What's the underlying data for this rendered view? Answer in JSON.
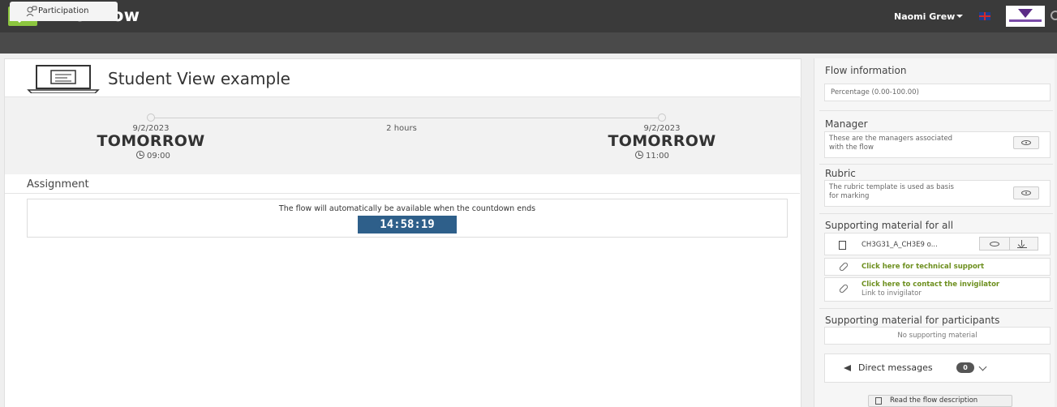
{
  "app": {
    "brand": "WISEflow",
    "logo_icon": "check-logo-icon"
  },
  "header": {
    "user_name": "Naomi Grew",
    "flag_icon": "uk-flag-icon",
    "institution_logo": "institution-logo"
  },
  "tabs": [
    {
      "label": "Participation",
      "icon": "participants-icon"
    }
  ],
  "main": {
    "title": "Student View example",
    "title_icon": "laptop-icon",
    "start": {
      "date": "9/2/2023",
      "day": "TOMORROW",
      "time": "09:00"
    },
    "duration": "2 hours",
    "end": {
      "date": "9/2/2023",
      "day": "TOMORROW",
      "time": "11:00"
    },
    "assignment": {
      "heading": "Assignment",
      "message": "The flow will automatically be available when the countdown ends",
      "countdown": "14:58:19"
    }
  },
  "sidebar": {
    "flow_info": {
      "heading": "Flow information",
      "text": "Percentage (0.00-100.00)"
    },
    "manager": {
      "heading": "Manager",
      "text_line1": "These are the managers associated",
      "text_line2": "with the flow"
    },
    "rubric": {
      "heading": "Rubric",
      "text_line1": "The rubric template is used as basis",
      "text_line2": "for marking"
    },
    "support_all": {
      "heading": "Supporting material for all",
      "file_name": "CH3G31_A_CH3E9 o...",
      "link1": "Click here for technical support",
      "link2": "Click here to contact the invigilator",
      "link2_sub": "Link to invigilator"
    },
    "support_participants": {
      "heading": "Supporting material for participants",
      "empty_text": "No supporting material"
    },
    "direct_messages": {
      "label": "Direct messages",
      "count": "0"
    },
    "read_description": "Read the flow description"
  },
  "colors": {
    "topbar": "#3a3a3a",
    "brand_green": "#8cc63f",
    "countdown_bg": "#2e5f8a",
    "link_green": "#6d8f1e"
  }
}
